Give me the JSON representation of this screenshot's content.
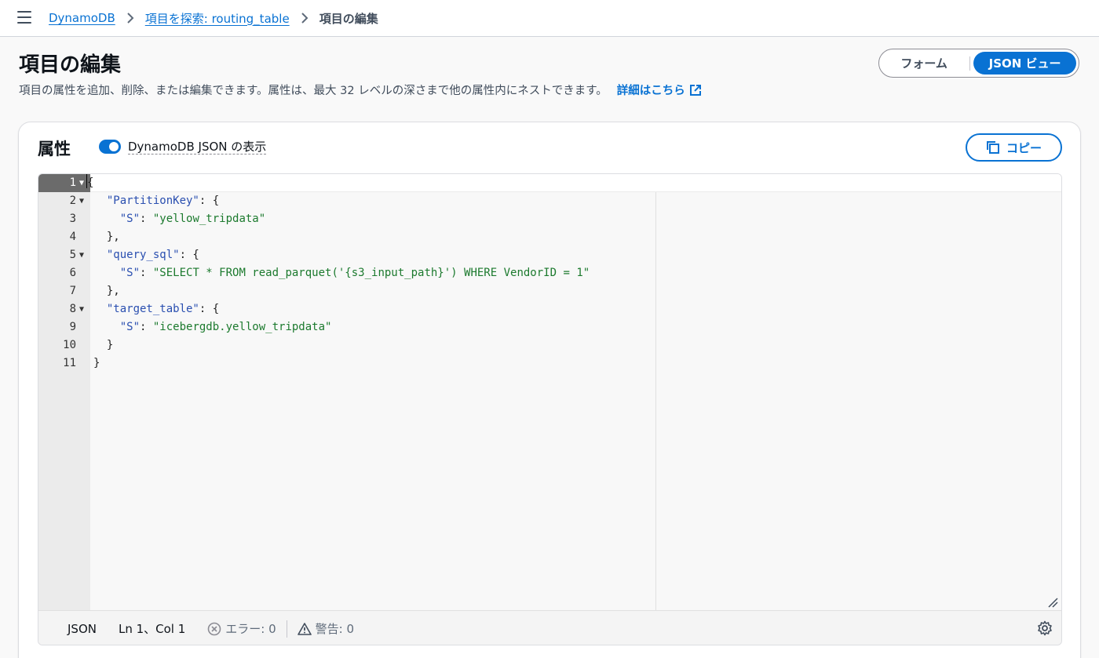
{
  "breadcrumb": {
    "items": [
      "DynamoDB",
      "項目を探索: routing_table"
    ],
    "current": "項目の編集"
  },
  "header": {
    "title": "項目の編集",
    "description": "項目の属性を追加、削除、または編集できます。属性は、最大 32 レベルの深さまで他の属性内にネストできます。",
    "learn_more": "詳細はこちら"
  },
  "view_toggle": {
    "form_label": "フォーム",
    "json_label": "JSON ビュー",
    "selected": "JSON ビュー"
  },
  "attributes": {
    "title": "属性",
    "toggle_label": "DynamoDB JSON の表示",
    "toggle_on": true,
    "copy_label": "コピー"
  },
  "editor": {
    "lines": [
      {
        "n": "1",
        "fold": true
      },
      {
        "n": "2",
        "fold": true
      },
      {
        "n": "3",
        "fold": false
      },
      {
        "n": "4",
        "fold": false
      },
      {
        "n": "5",
        "fold": true
      },
      {
        "n": "6",
        "fold": false
      },
      {
        "n": "7",
        "fold": false
      },
      {
        "n": "8",
        "fold": true
      },
      {
        "n": "9",
        "fold": false
      },
      {
        "n": "10",
        "fold": false
      },
      {
        "n": "11",
        "fold": false
      }
    ],
    "code": {
      "l1": "{",
      "l2_key": "\"PartitionKey\"",
      "l2_rest": ": {",
      "l3_key": "\"S\"",
      "l3_val": "\"yellow_tripdata\"",
      "l4": "},",
      "l5_key": "\"query_sql\"",
      "l5_rest": ": {",
      "l6_key": "\"S\"",
      "l6_val": "\"SELECT * FROM read_parquet('{s3_input_path}') WHERE VendorID = 1\"",
      "l7": "},",
      "l8_key": "\"target_table\"",
      "l8_rest": ": {",
      "l9_key": "\"S\"",
      "l9_val": "\"icebergdb.yellow_tripdata\"",
      "l10": "}",
      "l11": "}"
    },
    "status": {
      "mode": "JSON",
      "position": "Ln 1、Col 1",
      "errors": "エラー: 0",
      "warnings": "警告: 0"
    }
  },
  "icons": {
    "menu": "menu-icon",
    "breadcrumb_separator": "chevron-right-icon",
    "external": "external-link-icon",
    "copy": "copy-icon",
    "error": "error-circle-icon",
    "warning": "warning-triangle-icon",
    "settings": "gear-icon",
    "fold": "fold-arrow-icon"
  },
  "colors": {
    "accent": "#0972d3",
    "string": "#1c7a2e",
    "key": "#2a4fb0"
  }
}
